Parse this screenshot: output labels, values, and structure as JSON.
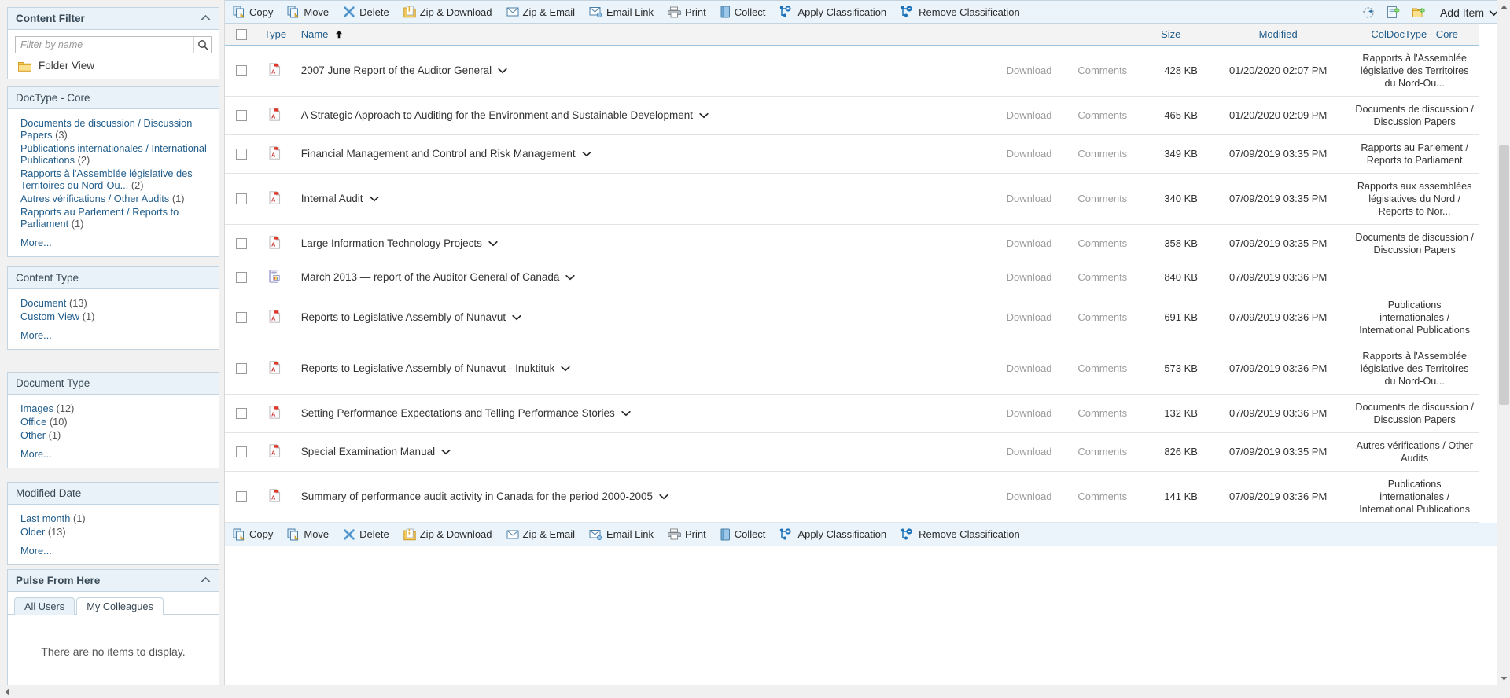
{
  "sidebar": {
    "content_filter": {
      "title": "Content Filter",
      "collapse_icon": "chevron-up-icon",
      "search": {
        "placeholder": "Filter by name",
        "value": "",
        "icon": "search-icon"
      },
      "folder_view": {
        "label": "Folder View",
        "icon": "folder-icon"
      }
    },
    "facets": [
      {
        "title": "DocType - Core",
        "items": [
          {
            "label": "Documents de discussion / Discussion Papers",
            "count": "(3)"
          },
          {
            "label": "Publications internationales / International Publications",
            "count": "(2)"
          },
          {
            "label": "Rapports à l'Assemblée législative des Territoires du Nord-Ou...",
            "count": "(2)"
          },
          {
            "label": "Autres vérifications / Other Audits",
            "count": "(1)"
          },
          {
            "label": "Rapports au Parlement / Reports to Parliament",
            "count": "(1)"
          }
        ],
        "more": "More..."
      },
      {
        "title": "Content Type",
        "items": [
          {
            "label": "Document",
            "count": "(13)"
          },
          {
            "label": "Custom View",
            "count": "(1)"
          }
        ],
        "more": "More..."
      },
      {
        "title": "Document Type",
        "items": [
          {
            "label": "Images",
            "count": "(12)"
          },
          {
            "label": "Office",
            "count": "(10)"
          },
          {
            "label": "Other",
            "count": "(1)"
          }
        ],
        "more": "More..."
      },
      {
        "title": "Modified Date",
        "items": [
          {
            "label": "Last month",
            "count": "(1)"
          },
          {
            "label": "Older",
            "count": "(13)"
          }
        ],
        "more": "More..."
      }
    ],
    "pulse": {
      "title": "Pulse From Here",
      "collapse_icon": "chevron-up-icon",
      "tabs": [
        {
          "label": "All Users",
          "active": true
        },
        {
          "label": "My Colleagues",
          "active": false
        }
      ],
      "empty_message": "There are no items to display."
    }
  },
  "toolbar": {
    "items": [
      {
        "label": "Copy",
        "icon": "copy-icon"
      },
      {
        "label": "Move",
        "icon": "move-icon"
      },
      {
        "label": "Delete",
        "icon": "delete-x-icon"
      },
      {
        "label": "Zip & Download",
        "icon": "zip-download-icon"
      },
      {
        "label": "Zip & Email",
        "icon": "zip-email-icon"
      },
      {
        "label": "Email Link",
        "icon": "email-link-icon"
      },
      {
        "label": "Print",
        "icon": "printer-icon"
      },
      {
        "label": "Collect",
        "icon": "collect-icon"
      },
      {
        "label": "Apply Classification",
        "icon": "apply-classification-icon"
      },
      {
        "label": "Remove Classification",
        "icon": "remove-classification-icon"
      }
    ],
    "right_icons": [
      {
        "name": "refresh-icon"
      },
      {
        "name": "add-document-icon"
      },
      {
        "name": "add-folder-icon"
      }
    ],
    "add_item": {
      "label": "Add Item",
      "icon": "chevron-down-icon"
    }
  },
  "table": {
    "columns": {
      "select_all": "select-all-checkbox",
      "type": "Type",
      "name": "Name",
      "name_sort_icon": "sort-ascending-icon",
      "download": "",
      "comments": "",
      "size": "Size",
      "modified": "Modified",
      "category": "ColDocType - Core"
    },
    "row_actions": {
      "download": "Download",
      "comments": "Comments"
    },
    "rows": [
      {
        "icon": "pdf-icon",
        "name": "2007 June Report of the Auditor General",
        "size": "428 KB",
        "modified": "01/20/2020 02:07 PM",
        "category": "Rapports à l'Assemblée législative des Territoires du Nord-Ou..."
      },
      {
        "icon": "pdf-icon",
        "name": "A Strategic Approach to Auditing for the Environment and Sustainable Development",
        "size": "465 KB",
        "modified": "01/20/2020 02:09 PM",
        "category": "Documents de discussion / Discussion Papers"
      },
      {
        "icon": "pdf-icon",
        "name": "Financial Management and Control and Risk Management",
        "size": "349 KB",
        "modified": "07/09/2019 03:35 PM",
        "category": "Rapports au Parlement / Reports to Parliament"
      },
      {
        "icon": "pdf-icon",
        "name": "Internal Audit",
        "size": "340 KB",
        "modified": "07/09/2019 03:35 PM",
        "category": "Rapports aux assemblées législatives du Nord / Reports to Nor..."
      },
      {
        "icon": "pdf-icon",
        "name": "Large Information Technology Projects",
        "size": "358 KB",
        "modified": "07/09/2019 03:35 PM",
        "category": "Documents de discussion / Discussion Papers"
      },
      {
        "icon": "custom-view-icon",
        "name": "March 2013 — report of the Auditor General of Canada",
        "size": "840 KB",
        "modified": "07/09/2019 03:36 PM",
        "category": ""
      },
      {
        "icon": "pdf-icon",
        "name": "Reports to Legislative Assembly of Nunavut",
        "size": "691 KB",
        "modified": "07/09/2019 03:36 PM",
        "category": "Publications internationales / International Publications"
      },
      {
        "icon": "pdf-icon",
        "name": "Reports to Legislative Assembly of Nunavut - Inuktituk",
        "size": "573 KB",
        "modified": "07/09/2019 03:36 PM",
        "category": "Rapports à l'Assemblée législative des Territoires du Nord-Ou..."
      },
      {
        "icon": "pdf-icon",
        "name": "Setting Performance Expectations and Telling Performance Stories",
        "size": "132 KB",
        "modified": "07/09/2019 03:36 PM",
        "category": "Documents de discussion / Discussion Papers"
      },
      {
        "icon": "pdf-icon",
        "name": "Special Examination Manual",
        "size": "826 KB",
        "modified": "07/09/2019 03:35 PM",
        "category": "Autres vérifications / Other Audits"
      },
      {
        "icon": "pdf-icon",
        "name": "Summary of performance audit activity in Canada for the period 2000-2005",
        "size": "141 KB",
        "modified": "07/09/2019 03:36 PM",
        "category": "Publications internationales / International Publications"
      }
    ]
  },
  "colors": {
    "panel_header_bg": "#e8f2f8",
    "panel_border": "#c3d4e0",
    "toolbar_bg": "#eaf4fa",
    "link": "#1f5c8b",
    "pdf_red": "#e03a27",
    "folder_yellow": "#f5c54a"
  }
}
